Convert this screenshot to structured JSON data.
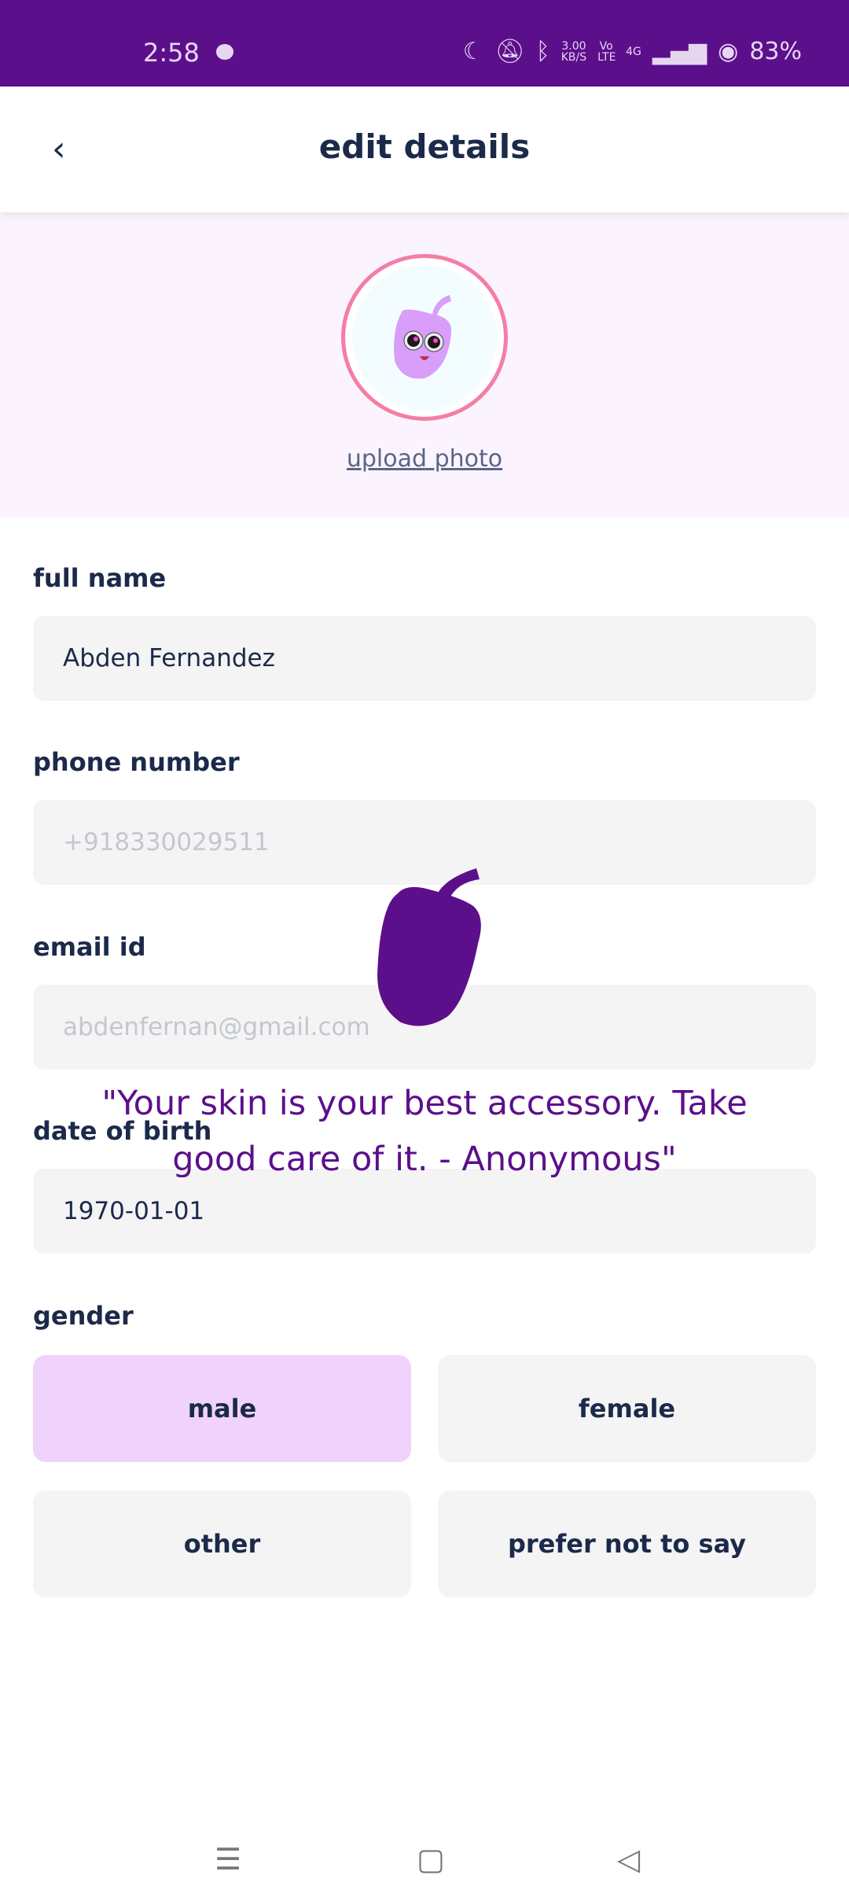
{
  "status_bar": {
    "time": "2:58",
    "net_speed": "3.00",
    "net_unit": "KB/S",
    "volte": "Vo LTE",
    "network": "4G",
    "battery": "83%"
  },
  "header": {
    "title": "edit details"
  },
  "avatar": {
    "upload_label": "upload photo"
  },
  "form": {
    "full_name": {
      "label": "full name",
      "value": "Abden Fernandez"
    },
    "phone": {
      "label": "phone number",
      "value": "+918330029511"
    },
    "email": {
      "label": "email id",
      "value": "abdenfernan@gmail.com"
    },
    "dob": {
      "label": "date of birth",
      "value": "1970-01-01"
    },
    "gender": {
      "label": "gender",
      "options": [
        "male",
        "female",
        "other",
        "prefer not to say"
      ],
      "selected": "male"
    }
  },
  "overlay": {
    "quote_line1": "\"Your skin is your best accessory. Take",
    "quote_line2": "good care of it. - Anonymous\""
  },
  "colors": {
    "brand": "#5c0f8b",
    "selected": "#efd3fd",
    "avatar_ring": "#f47ea5"
  }
}
